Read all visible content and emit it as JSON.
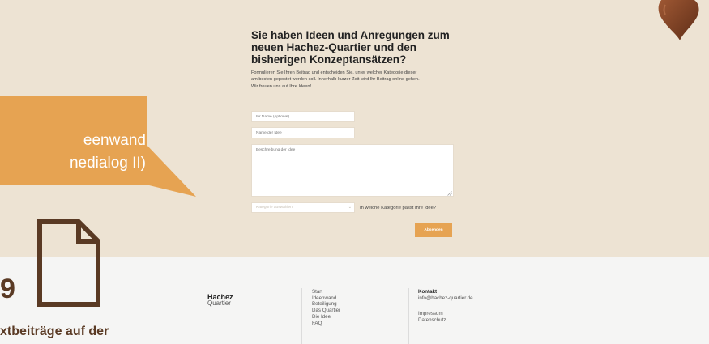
{
  "form": {
    "heading": "Sie haben Ideen und Anregungen zum neuen Hachez-Quartier und den bisherigen Konzeptansätzen?",
    "description": [
      "Formulieren Sie Ihren Beitrag und entscheiden Sie, unter welcher Kategorie dieser",
      "am besten gepostet werden soll. Innerhalb kurzer Zeit wird Ihr Beitrag online gehen.",
      "Wir freuen uns auf Ihre Ideen!"
    ],
    "name_placeholder": "Ihr Name (optional)",
    "idea_placeholder": "Name der Idee",
    "text_placeholder": "Beschreibung der Idee",
    "category_placeholder": "Kategorie auswählen",
    "category_question": "In welche Kategorie passt Ihre Idee?",
    "submit_label": "Absenden"
  },
  "footer": {
    "logo_top": "Hachez",
    "logo_bottom": "Quartier",
    "nav": [
      "Start",
      "Ideenwand",
      "Beteiligung",
      "Das Quartier",
      "Die Idee",
      "FAQ"
    ],
    "contact_title": "Kontakt",
    "contact_email": "info@hachez-quartier.de",
    "legal": [
      "Impressum",
      "Datenschutz"
    ]
  },
  "slide": {
    "callout_line1": "eenwand",
    "callout_line2": "nedialog II)",
    "number": "9",
    "caption": "xtbeiträge auf der"
  },
  "colors": {
    "background_beige": "#ede3d3",
    "accent_orange": "#e6a352",
    "brown": "#5a3a24",
    "heart": "#7a3e22"
  }
}
